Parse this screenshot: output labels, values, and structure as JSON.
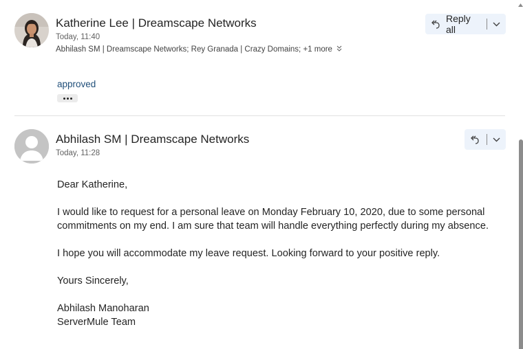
{
  "messages": [
    {
      "sender": "Katherine Lee | Dreamscape Networks",
      "time": "Today, 11:40",
      "recipients": [
        "Abhilash SM | Dreamscape Networks;",
        "Rey Granada | Crazy Domains;"
      ],
      "more_recipients": "+1 more",
      "reply_label": "Reply all",
      "body": "approved",
      "avatar": "profile-photo"
    },
    {
      "sender": "Abhilash SM | Dreamscape Networks",
      "time": "Today, 11:28",
      "avatar": "default-person",
      "body": {
        "greeting": "Dear Katherine,",
        "para1_line1": "I would like to request for a personal leave on Monday February 10, 2020, due to some personal",
        "para1_line2": "commitments on my end. I am sure that team will handle everything perfectly during my absence.",
        "para2": "I hope you will accommodate my leave request. Looking forward to your positive reply.",
        "closing": "Yours Sincerely,",
        "signature_name": "Abhilash Manoharan",
        "signature_team": "ServerMule Team"
      }
    }
  ],
  "colors": {
    "accent_link": "#1f4e79",
    "button_bg": "#edf3fb",
    "scrollbar": "#8c8c8c"
  }
}
